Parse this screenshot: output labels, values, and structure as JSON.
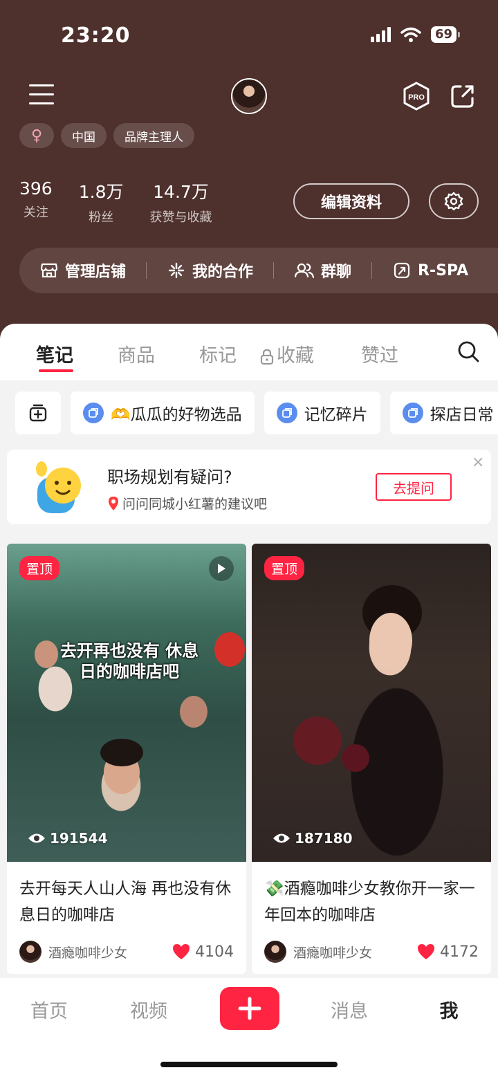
{
  "status_bar": {
    "time": "23:20",
    "battery": "69"
  },
  "profile": {
    "tags": [
      "中国",
      "品牌主理人"
    ],
    "stats": [
      {
        "num": "396",
        "label": "关注"
      },
      {
        "num": "1.8万",
        "label": "粉丝"
      },
      {
        "num": "14.7万",
        "label": "获赞与收藏"
      }
    ],
    "edit_label": "编辑资料",
    "shortcuts": [
      "管理店铺",
      "我的合作",
      "群聊",
      "R-SPA"
    ]
  },
  "tabs": [
    "笔记",
    "商品",
    "标记",
    "收藏",
    "赞过"
  ],
  "chips": [
    "🫶瓜瓜的好物选品",
    "记忆碎片",
    "探店日常"
  ],
  "tip": {
    "title": "职场规划有疑问?",
    "subtitle": "问问同城小红薯的建议吧",
    "button": "去提问",
    "close": "×"
  },
  "posts": [
    {
      "badge": "置顶",
      "overlay": "去开再也没有 休息日的咖啡店吧",
      "views": "191544",
      "title": "去开每天人山人海 再也没有休息日的咖啡店",
      "author": "酒瘾咖啡少女",
      "likes": "4104"
    },
    {
      "badge": "置顶",
      "views": "187180",
      "title": "💸酒瘾咖啡少女教你开一家一年回本的咖啡店",
      "author": "酒瘾咖啡少女",
      "likes": "4172"
    }
  ],
  "bottom_nav": [
    "首页",
    "视频",
    "消息",
    "我"
  ],
  "colors": {
    "header_bg": "#4e302c",
    "accent": "#ff2442"
  }
}
